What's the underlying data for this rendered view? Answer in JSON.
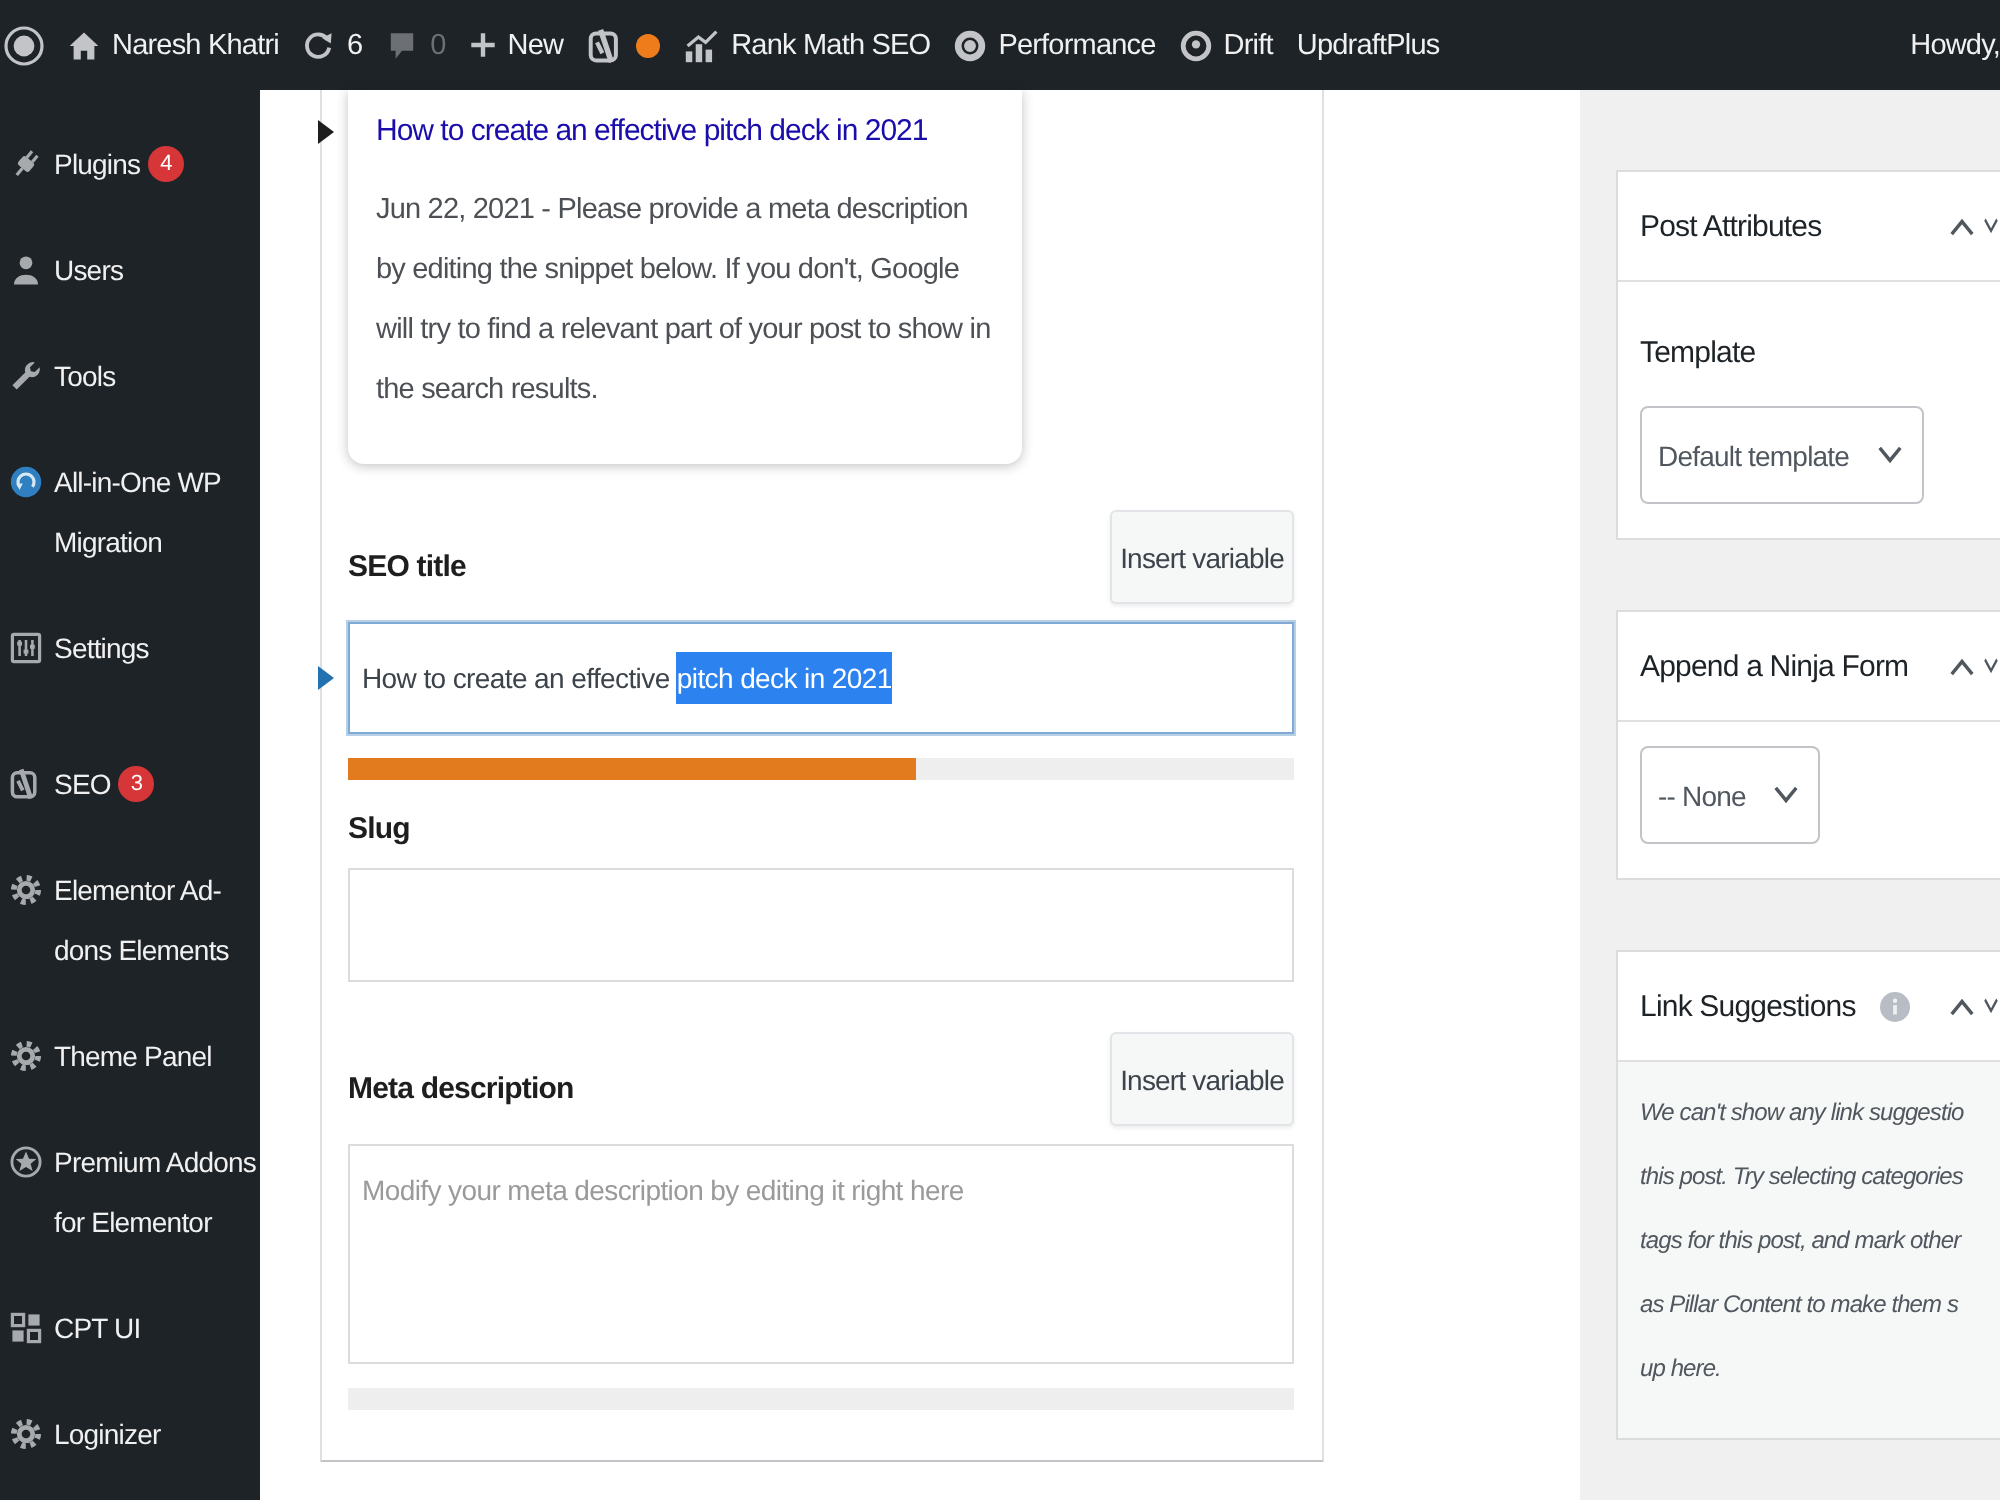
{
  "admin_bar": {
    "items": [
      {
        "kind": "logo",
        "dimmed": false
      },
      {
        "kind": "home",
        "label": "Naresh Khatri",
        "dimmed": false
      },
      {
        "kind": "updates",
        "label": "6",
        "dimmed": false
      },
      {
        "kind": "comments",
        "label": "0",
        "dimmed": true
      },
      {
        "kind": "new",
        "label": "New",
        "dimmed": false
      },
      {
        "kind": "yoast",
        "dimmed": false
      },
      {
        "kind": "rank_math",
        "label": "Rank Math SEO",
        "dimmed": false
      },
      {
        "kind": "performance",
        "label": "Performance",
        "dimmed": false
      },
      {
        "kind": "drift",
        "label": "Drift",
        "dimmed": false
      },
      {
        "kind": "plain",
        "label": "UpdraftPlus",
        "dimmed": false
      }
    ],
    "greeting": "Howdy,"
  },
  "sidebar": {
    "groups": [
      {
        "items": [
          {
            "kind": "plugins",
            "label": "Plugins",
            "badge": "4"
          },
          {
            "kind": "users",
            "label": "Users"
          },
          {
            "kind": "tools",
            "label": "Tools"
          },
          {
            "kind": "migration",
            "label": "All-in-One WP Migration"
          },
          {
            "kind": "settings",
            "label": "Settings"
          }
        ]
      },
      {
        "items": [
          {
            "kind": "seo",
            "label": "SEO",
            "badge": "3"
          },
          {
            "kind": "gear",
            "label": "Elementor Ad-dons Elements"
          },
          {
            "kind": "gear",
            "label": "Theme Panel"
          },
          {
            "kind": "star",
            "label": "Premium Addons for Elementor"
          },
          {
            "kind": "grid",
            "label": "CPT UI"
          },
          {
            "kind": "gear",
            "label": "Loginizer"
          }
        ]
      }
    ]
  },
  "editor": {
    "snippet": {
      "title": "How to create an effective pitch deck in 2021",
      "description": "Jun 22, 2021 - Please provide a meta description by editing the snippet below. If you don't, Google will try to find a relevant part of your post to show in the search results."
    },
    "fields": [
      {
        "kind": "title",
        "label": "SEO title",
        "button": "Insert variable",
        "focused": true,
        "value_parts": [
          {
            "text": "How to create an effective ",
            "selected": false
          },
          {
            "text": "pitch deck in 2021",
            "selected": true
          }
        ],
        "level": 0.6
      },
      {
        "kind": "slug",
        "label": "Slug",
        "focused": false
      },
      {
        "kind": "description",
        "label": "Meta description",
        "button": "Insert variable",
        "focused": false,
        "placeholder": "Modify your meta description by editing it right here",
        "level": 0
      }
    ]
  },
  "right_sidebar": {
    "panels": [
      {
        "kind": "select",
        "title": "Post Attributes",
        "help_icon": false,
        "field_label": "Template",
        "value": "Default template"
      },
      {
        "kind": "select",
        "title": "Append a Ninja Form",
        "help_icon": false,
        "value": "-- None"
      },
      {
        "kind": "text",
        "title": "Link Suggestions",
        "help_icon": true,
        "lines": [
          "We can't show any link suggestio",
          "this post. Try selecting categories",
          "tags for this post, and mark other",
          "as Pillar Content to make them s",
          "up here."
        ]
      }
    ]
  }
}
